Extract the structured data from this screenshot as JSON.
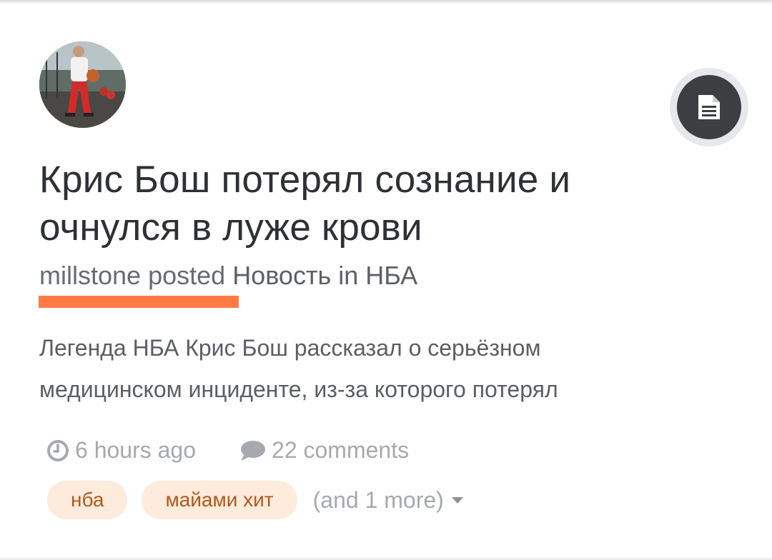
{
  "post": {
    "title": "Крис Бош потерял сознание и очнулся в луже крови",
    "author": "millstone",
    "posted_word": "posted",
    "type": "Новость",
    "in_word": "in",
    "category": "НБА",
    "excerpt": "Легенда НБА Крис Бош рассказал о серьёзном медицинском инциденте, из-за которого потерял",
    "time_ago": "6 hours ago",
    "comments": "22 comments"
  },
  "tags": [
    {
      "label": "нба"
    },
    {
      "label": "майами хит"
    }
  ],
  "more_tags": "(and 1 more)",
  "icons": {
    "type_button": "document-icon",
    "time": "clock-icon",
    "comments": "speech-bubble-icon",
    "more": "caret-down-icon"
  },
  "colors": {
    "highlight": "#ff7a45",
    "tag_bg": "#fdebdc",
    "tag_text": "#b0581c",
    "type_button": "#3c3e42"
  }
}
